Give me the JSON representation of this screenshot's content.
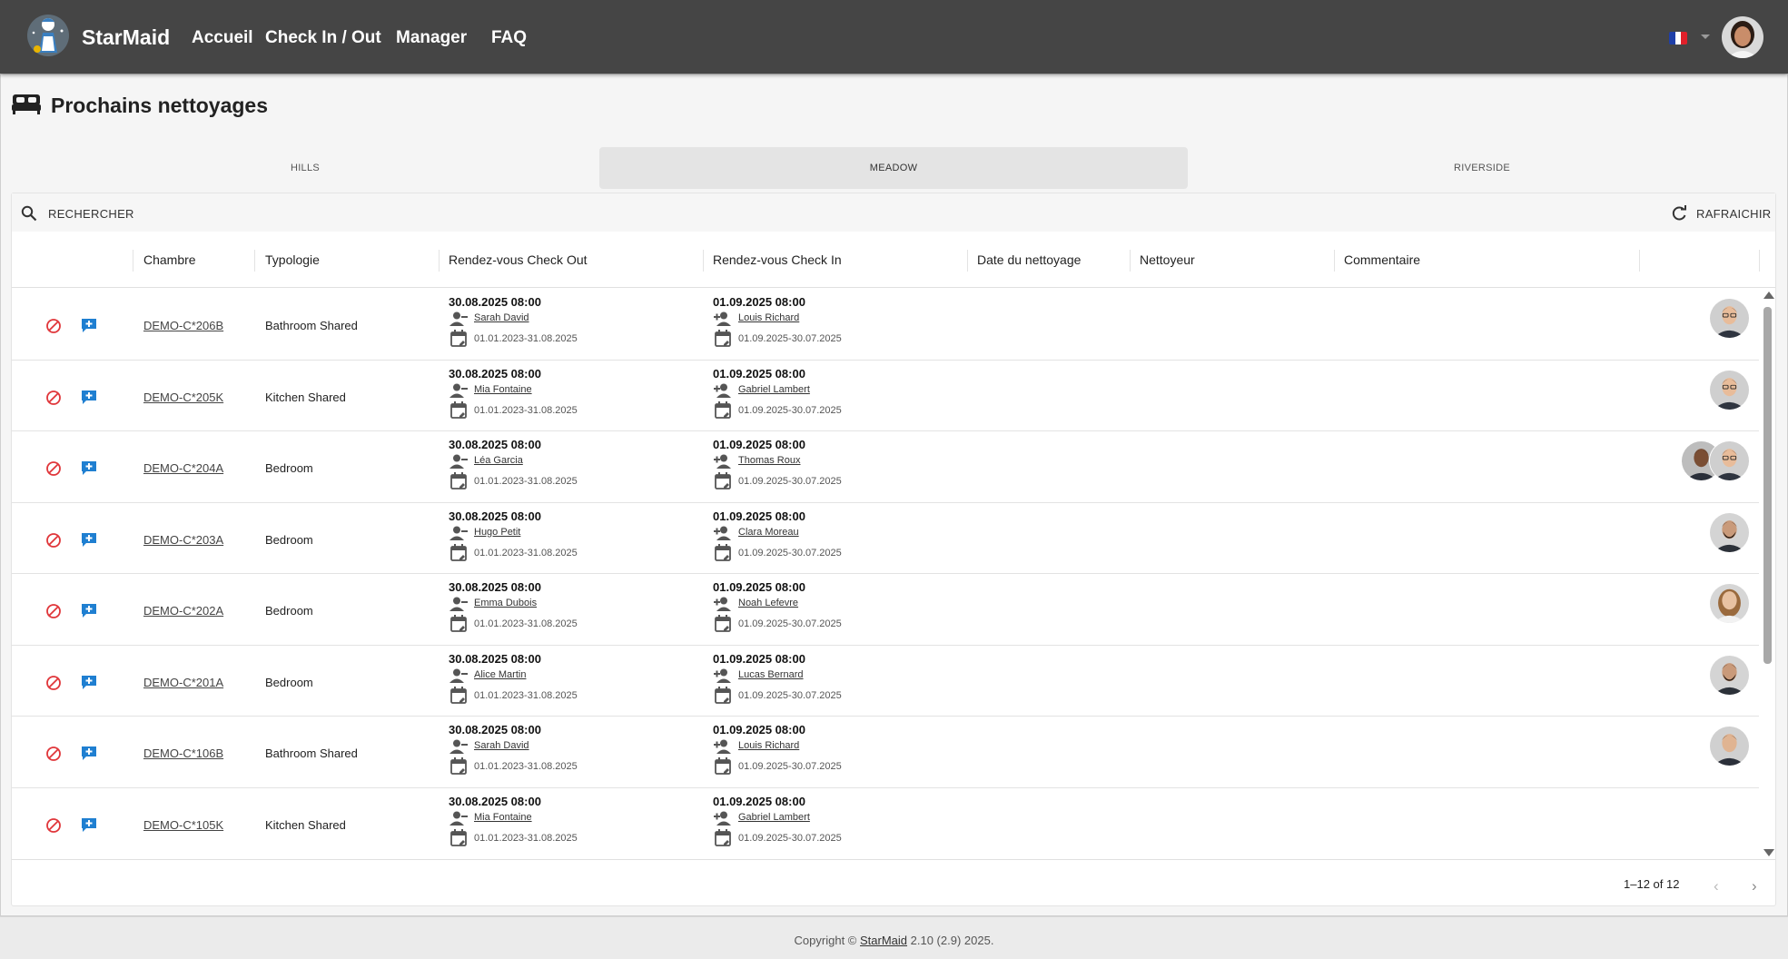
{
  "navbar": {
    "brand": "StarMaid",
    "links": [
      "Accueil",
      "Check In / Out",
      "Manager",
      "FAQ"
    ],
    "flag_colors": [
      "#1f3fa8",
      "#ffffff",
      "#e0202a"
    ]
  },
  "page": {
    "title": "Prochains nettoyages",
    "tabs": [
      {
        "label": "HILLS",
        "active": false
      },
      {
        "label": "MEADOW",
        "active": true
      },
      {
        "label": "RIVERSIDE",
        "active": false
      }
    ],
    "search_label": "RECHERCHER",
    "refresh_label": "RAFRAICHIR"
  },
  "table": {
    "columns": [
      "Chambre",
      "Typologie",
      "Rendez-vous Check Out",
      "Rendez-vous Check In",
      "Date du nettoyage",
      "Nettoyeur",
      "Commentaire"
    ],
    "rows": [
      {
        "room": "DEMO-C*206B",
        "typology": "Bathroom Shared",
        "checkout_date": "30.08.2025 08:00",
        "checkout_guest": "Sarah David",
        "checkout_range": "01.01.2023-31.08.2025",
        "checkin_date": "01.09.2025 08:00",
        "checkin_guest": "Louis Richard",
        "checkin_range": "01.09.2025-30.07.2025",
        "avatars": [
          "man-glasses"
        ]
      },
      {
        "room": "DEMO-C*205K",
        "typology": "Kitchen Shared",
        "checkout_date": "30.08.2025 08:00",
        "checkout_guest": "Mia Fontaine",
        "checkout_range": "01.01.2023-31.08.2025",
        "checkin_date": "01.09.2025 08:00",
        "checkin_guest": "Gabriel Lambert",
        "checkin_range": "01.09.2025-30.07.2025",
        "avatars": [
          "man-glasses"
        ]
      },
      {
        "room": "DEMO-C*204A",
        "typology": "Bedroom",
        "checkout_date": "30.08.2025 08:00",
        "checkout_guest": "Léa Garcia",
        "checkout_range": "01.01.2023-31.08.2025",
        "checkin_date": "01.09.2025 08:00",
        "checkin_guest": "Thomas Roux",
        "checkin_range": "01.09.2025-30.07.2025",
        "avatars": [
          "man-bald",
          "man-glasses"
        ]
      },
      {
        "room": "DEMO-C*203A",
        "typology": "Bedroom",
        "checkout_date": "30.08.2025 08:00",
        "checkout_guest": "Hugo Petit",
        "checkout_range": "01.01.2023-31.08.2025",
        "checkin_date": "01.09.2025 08:00",
        "checkin_guest": "Clara Moreau",
        "checkin_range": "01.09.2025-30.07.2025",
        "avatars": [
          "man-beard"
        ]
      },
      {
        "room": "DEMO-C*202A",
        "typology": "Bedroom",
        "checkout_date": "30.08.2025 08:00",
        "checkout_guest": "Emma Dubois",
        "checkout_range": "01.01.2023-31.08.2025",
        "checkin_date": "01.09.2025 08:00",
        "checkin_guest": "Noah Lefevre",
        "checkin_range": "01.09.2025-30.07.2025",
        "avatars": [
          "woman"
        ]
      },
      {
        "room": "DEMO-C*201A",
        "typology": "Bedroom",
        "checkout_date": "30.08.2025 08:00",
        "checkout_guest": "Alice Martin",
        "checkout_range": "01.01.2023-31.08.2025",
        "checkin_date": "01.09.2025 08:00",
        "checkin_guest": "Lucas Bernard",
        "checkin_range": "01.09.2025-30.07.2025",
        "avatars": [
          "man-beard"
        ]
      },
      {
        "room": "DEMO-C*106B",
        "typology": "Bathroom Shared",
        "checkout_date": "30.08.2025 08:00",
        "checkout_guest": "Sarah David",
        "checkout_range": "01.01.2023-31.08.2025",
        "checkin_date": "01.09.2025 08:00",
        "checkin_guest": "Louis Richard",
        "checkin_range": "01.09.2025-30.07.2025",
        "avatars": [
          "man-short"
        ]
      },
      {
        "room": "DEMO-C*105K",
        "typology": "Kitchen Shared",
        "checkout_date": "30.08.2025 08:00",
        "checkout_guest": "Mia Fontaine",
        "checkout_range": "01.01.2023-31.08.2025",
        "checkin_date": "01.09.2025 08:00",
        "checkin_guest": "Gabriel Lambert",
        "checkin_range": "01.09.2025-30.07.2025",
        "avatars": []
      }
    ],
    "pagination": "1–12 of 12"
  },
  "footer": {
    "prefix": "Copyright © ",
    "link": "StarMaid",
    "suffix": " 2.10 (2.9) 2025."
  },
  "colors": {
    "navbar_bg": "#454545",
    "ban_red": "#e0363a",
    "comment_blue": "#1f7fd1"
  }
}
